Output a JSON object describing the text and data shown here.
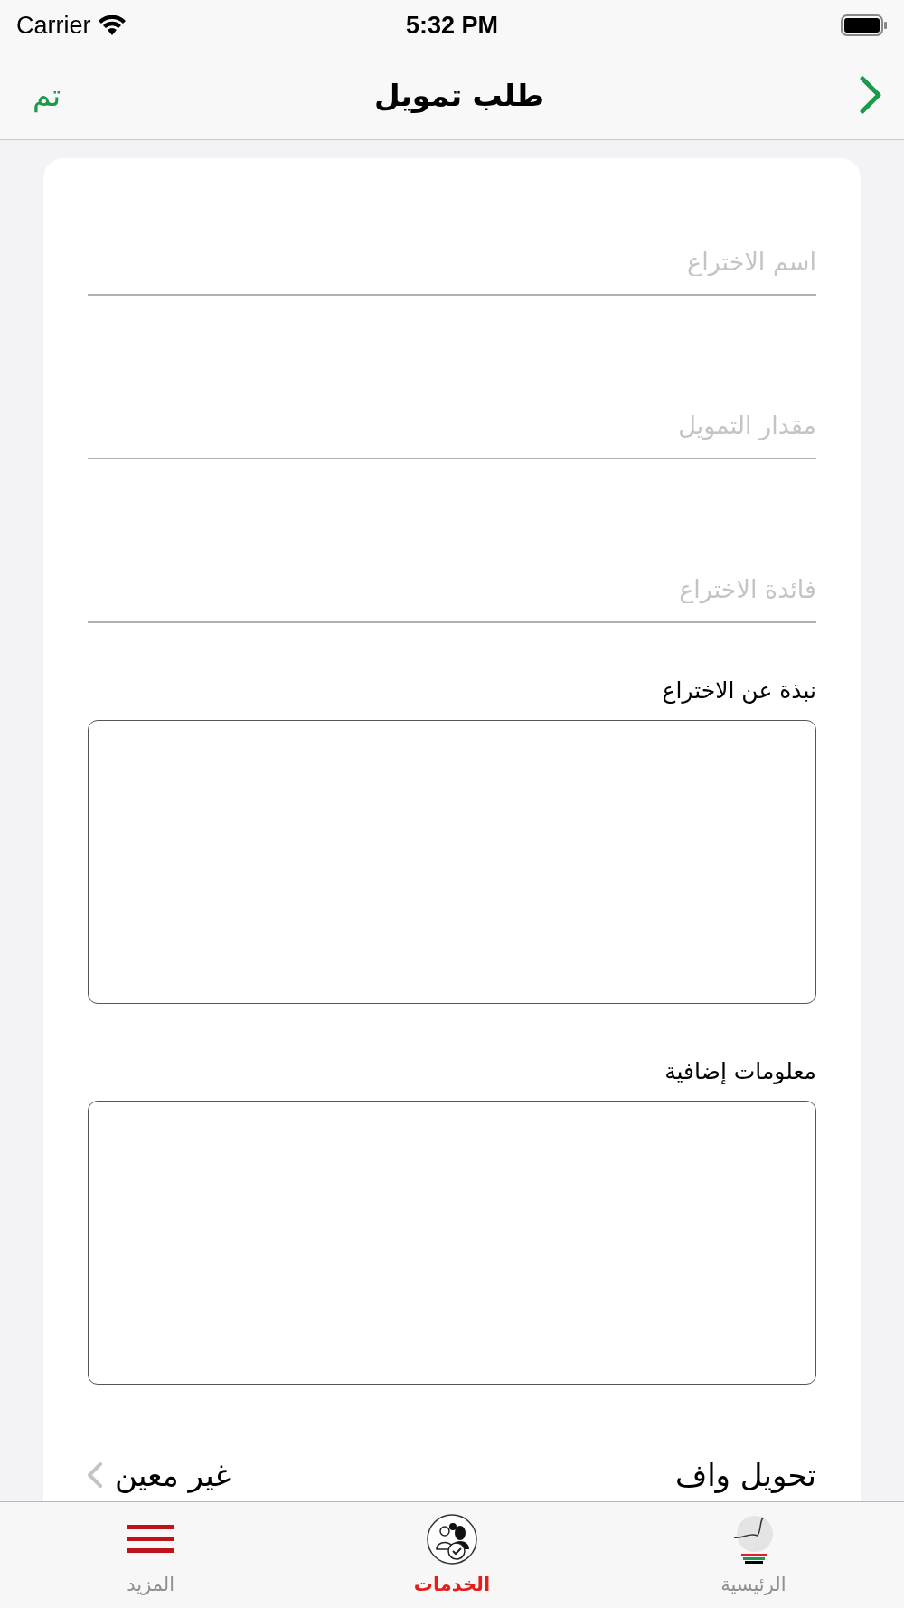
{
  "status_bar": {
    "carrier": "Carrier",
    "time": "5:32 PM"
  },
  "nav_bar": {
    "title": "طلب تمويل",
    "done_button": "تم"
  },
  "form": {
    "fields": [
      {
        "kind": "line",
        "placeholder": "اسم الاختراع"
      },
      {
        "kind": "line",
        "placeholder": "مقدار التمويل"
      },
      {
        "kind": "line",
        "placeholder": "فائدة الاختراع"
      },
      {
        "kind": "area",
        "label": "نبذة عن الاختراع"
      },
      {
        "kind": "area",
        "label": "معلومات إضافية"
      },
      {
        "kind": "picker",
        "label": "تحويل واف",
        "value": "غير معين"
      }
    ]
  },
  "tab_bar": {
    "items": [
      {
        "kind": "home",
        "label": "الرئيسية",
        "selected": false
      },
      {
        "kind": "services",
        "label": "الخدمات",
        "selected": true
      },
      {
        "kind": "more",
        "label": "المزيد",
        "selected": false
      }
    ]
  }
}
